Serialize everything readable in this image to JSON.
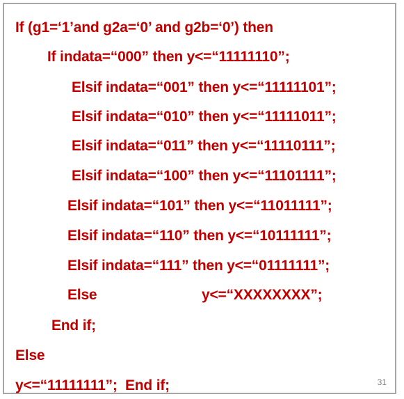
{
  "code": {
    "line1": "If (g1=‘1’and g2a=‘0’ and g2b=‘0’) then",
    "line2": "If indata=“000” then y<=“11111110”;",
    "line3": "Elsif indata=“001” then y<=“11111101”;",
    "line4": "Elsif indata=“010” then y<=“11111011”;",
    "line5": "Elsif indata=“011” then y<=“11110111”;",
    "line6": "Elsif indata=“100” then y<=“11101111”;",
    "line7": "Elsif indata=“101” then y<=“11011111”;",
    "line8": "Elsif indata=“110” then y<=“10111111”;",
    "line9": "Elsif indata=“111” then y<=“01111111”;",
    "line10_keyword": "Else",
    "line10_assign": "y<=“XXXXXXXX”;",
    "line11": "End if;",
    "line12": "Else",
    "line13": "y<=“11111111”;  End if;"
  },
  "page_number": "31",
  "colors": {
    "code_text": "#c00000",
    "border": "#a6a6a6",
    "page_number": "#7f7f7f"
  }
}
